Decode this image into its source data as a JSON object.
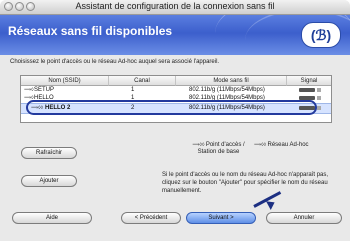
{
  "window": {
    "title": "Assistant de configuration de la connexion sans fil"
  },
  "banner": {
    "heading": "Réseaux sans fil disponibles",
    "logo_text": "(ℬ)"
  },
  "description": "Choisissez le point d'accès ou le réseau Ad-hoc auquel sera associé l'appareil.",
  "table": {
    "headers": [
      "Nom (SSID)",
      "Canal",
      "Mode sans fil",
      "Signal"
    ],
    "rows": [
      {
        "ssid": "SETUP",
        "channel": "1",
        "mode": "802.11b/g (11Mbps/54Mbps)",
        "signal_level": 0.75,
        "selected": false
      },
      {
        "ssid": "HELLO",
        "channel": "1",
        "mode": "802.11b/g (11Mbps/54Mbps)",
        "signal_level": 0.75,
        "selected": false
      },
      {
        "ssid": "HELLO 2",
        "channel": "2",
        "mode": "802.11b/g (11Mbps/54Mbps)",
        "signal_level": 0.75,
        "selected": true
      }
    ]
  },
  "buttons": {
    "refresh": "Rafraîchir",
    "add": "Ajouter",
    "help": "Aide",
    "previous": "< Précédent",
    "next": "Suivant >",
    "cancel": "Annuler"
  },
  "legend": {
    "access_point": "Point d'accès / Station de base",
    "adhoc": "Réseau Ad-hoc"
  },
  "note": "Si le point d'accès ou le nom du réseau Ad-hoc n'apparaît pas, cliquez sur le bouton \"Ajouter\" pour spécifier le nom du réseau manuellement."
}
